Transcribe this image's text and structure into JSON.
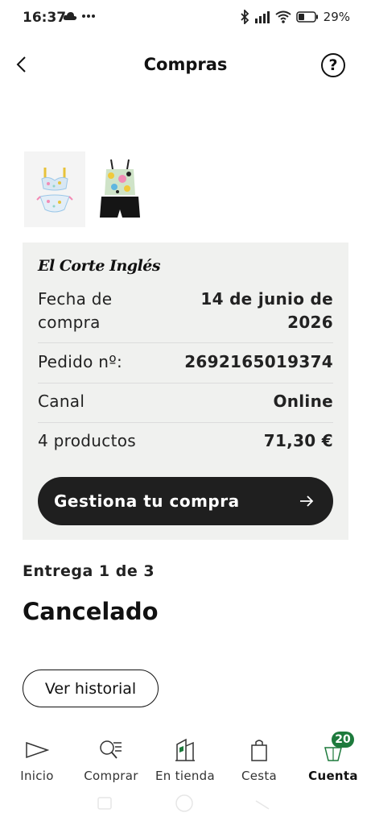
{
  "status_bar": {
    "time": "16:37",
    "battery": "29%"
  },
  "header": {
    "title": "Compras",
    "help_label": "?"
  },
  "order": {
    "brand": "El Corte Inglés",
    "rows": [
      {
        "label": "Fecha de compra",
        "value": "14 de junio de 2026"
      },
      {
        "label": "Pedido nº:",
        "value": "2692165019374"
      },
      {
        "label": "Canal",
        "value": "Online"
      },
      {
        "label": "4 productos",
        "value": "71,30 €"
      }
    ],
    "manage_label": "Gestiona tu compra"
  },
  "delivery": {
    "label": "Entrega 1 de 3",
    "status": "Cancelado",
    "history_label": "Ver historial"
  },
  "bottom_nav": {
    "items": [
      {
        "label": "Inicio",
        "icon": "play-triangle-icon"
      },
      {
        "label": "Comprar",
        "icon": "search-list-icon"
      },
      {
        "label": "En tienda",
        "icon": "store-building-icon"
      },
      {
        "label": "Cesta",
        "icon": "shopping-bag-icon"
      },
      {
        "label": "Cuenta",
        "icon": "account-icon",
        "badge": "20",
        "active": true
      }
    ]
  },
  "colors": {
    "card_bg": "#f0f1ef",
    "button_dark": "#1f1f1f",
    "badge_green": "#1d7a3c"
  }
}
